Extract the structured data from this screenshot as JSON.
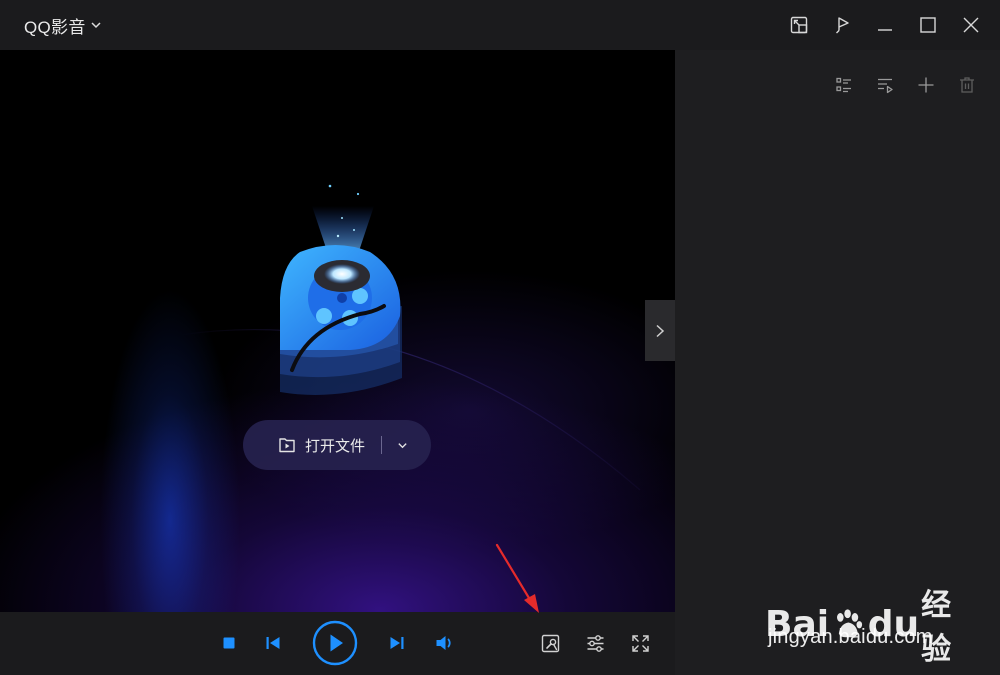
{
  "titlebar": {
    "app_title": "QQ影音",
    "icons": [
      "chevron-down-icon",
      "mini-mode-icon",
      "pin-icon",
      "minimize-icon",
      "maximize-icon",
      "close-icon"
    ]
  },
  "video_area": {
    "open_file_label": "打开文件",
    "icons": [
      "play-file-icon",
      "chevron-down-icon",
      "chevron-right-icon"
    ]
  },
  "playlist": {
    "icons": [
      "list-view-icon",
      "playlist-mode-icon",
      "add-icon",
      "delete-icon"
    ]
  },
  "controls": {
    "icons": [
      "stop-icon",
      "previous-icon",
      "play-icon",
      "next-icon",
      "volume-icon",
      "toolbox-icon",
      "settings-sliders-icon",
      "fullscreen-icon"
    ]
  },
  "colors": {
    "accent": "#1e90ff",
    "background": "#1b1b1d",
    "annotation_arrow": "#e52b2b"
  },
  "watermark": {
    "brand_latin_1": "Bai",
    "brand_latin_2": "du",
    "brand_cn": "经验",
    "url": "jingyan.baidu.com"
  }
}
